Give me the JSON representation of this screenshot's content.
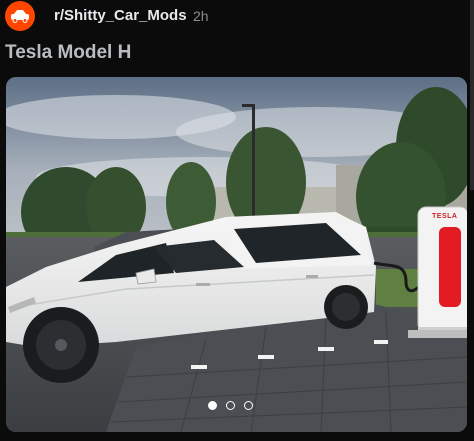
{
  "post": {
    "subreddit": "r/Shitty_Car_Mods",
    "age": "2h",
    "title": "Tesla Model H"
  },
  "image": {
    "sign_text": "TESLA",
    "carousel": {
      "count": 3,
      "active_index": 0
    }
  },
  "colors": {
    "background": "#0b0b0c",
    "subreddit_avatar": "#ff4500",
    "supercharger_red": "#e31b23"
  },
  "icons": [
    "subreddit-avatar-icon"
  ]
}
